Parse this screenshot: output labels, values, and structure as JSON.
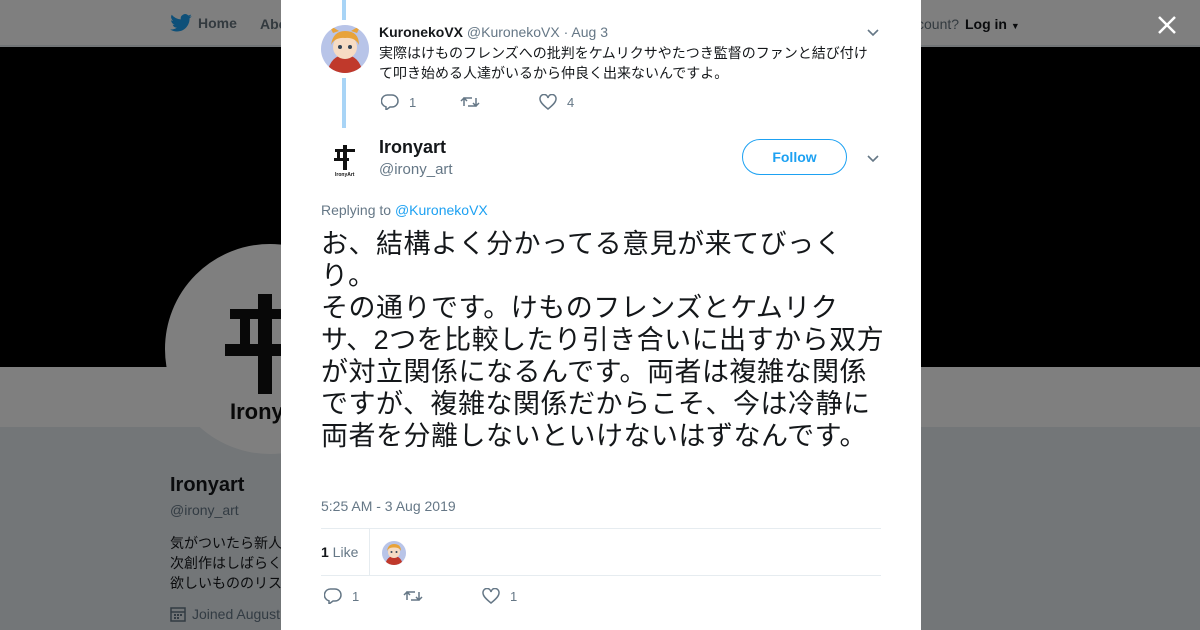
{
  "background": {
    "nav": {
      "home": "Home",
      "about": "Abo",
      "account": "ccount?",
      "login": "Log in"
    },
    "profile": {
      "name": "Ironyart",
      "handle": "@irony_art",
      "bio": [
        "気がついたら新人",
        "次創作はしばらく",
        "欲しいもののリス"
      ],
      "joined": "Joined August"
    }
  },
  "reply": {
    "name": "KuronekoVX",
    "handle": "@KuronekoVX",
    "date": "· Aug 3",
    "text": "実際はけものフレンズへの批判をケムリクサやたつき監督のファンと結び付けて叩き始める人達がいるから仲良く出来ないんですよ。",
    "replies": "1",
    "retweets": "",
    "likes": "4"
  },
  "tweet": {
    "name": "Ironyart",
    "handle": "@irony_art",
    "follow": "Follow",
    "replying_label": "Replying to ",
    "replying_to": "@KuronekoVX",
    "text": "お、結構よく分かってる意見が来てびっくり。\nその通りです。けものフレンズとケムリクサ、2つを比較したり引き合いに出すから双方が対立関係になるんです。両者は複雑な関係ですが、複雑な関係だからこそ、今は冷静に両者を分離しないといけないはずなんです。",
    "timestamp": "5:25 AM - 3 Aug 2019",
    "like_count": "1",
    "like_label": " Like",
    "replies": "1",
    "retweets": "",
    "likes": "1"
  },
  "colors": {
    "accent": "#1da1f2",
    "thread": "#a8d4f6",
    "muted": "#657786"
  }
}
